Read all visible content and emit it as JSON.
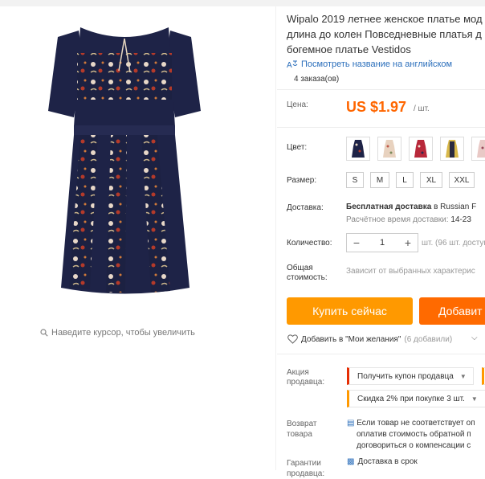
{
  "product": {
    "title_lines": [
      "Wipalo 2019 летнее женское платье мод",
      "длина до колен Повседневные платья д",
      "богемное платье Vestidos"
    ],
    "translate_link": "Посмотреть название на английском",
    "orders": "4 заказа(ов)",
    "zoom_hint": "Наведите курсор, чтобы увеличить"
  },
  "price": {
    "label": "Цена:",
    "value": "US $1.97",
    "unit": "/ шт."
  },
  "color": {
    "label": "Цвет:",
    "swatches": [
      "navy-floral",
      "beige-floral",
      "red-floral",
      "yellow-stripe",
      "pink-floral"
    ]
  },
  "size": {
    "label": "Размер:",
    "options": [
      "S",
      "M",
      "L",
      "XL",
      "XXL"
    ]
  },
  "shipping": {
    "label": "Доставка:",
    "free": "Бесплатная доставка",
    "to": " в Russian F",
    "estimate_label": "Расчётное время доставки:",
    "estimate_value": " 14-23"
  },
  "quantity": {
    "label": "Количество:",
    "value": "1",
    "minus": "−",
    "plus": "+",
    "note": "шт. (96 шт. доступ"
  },
  "total": {
    "label_line1": "Общая",
    "label_line2": "стоимость:",
    "note": "Зависит от выбранных характерис"
  },
  "buttons": {
    "buy": "Купить сейчас",
    "cart": "Добавит"
  },
  "wishlist": {
    "text": "Добавить в \"Мои желания\"",
    "count": "(6 добавили)"
  },
  "promo": {
    "label_line1": "Акция",
    "label_line2": "продавца:",
    "coupon": "Получить купон продавца",
    "discount": "Скидка 2% при покупке 3 шт."
  },
  "returns": {
    "label_line1": "Возврат",
    "label_line2": "товара",
    "lines": [
      "Если товар не соответствует оп",
      "оплатив стоимость обратной п",
      "договориться о компенсации с"
    ]
  },
  "guarantee": {
    "label_line1": "Гарантии",
    "label_line2": "продавца:",
    "text": "Доставка в срок"
  },
  "colors": {
    "price": "#ff6600",
    "buy_button": "#ff9900",
    "cart_button": "#ff6a00",
    "link": "#2a6ebb"
  }
}
